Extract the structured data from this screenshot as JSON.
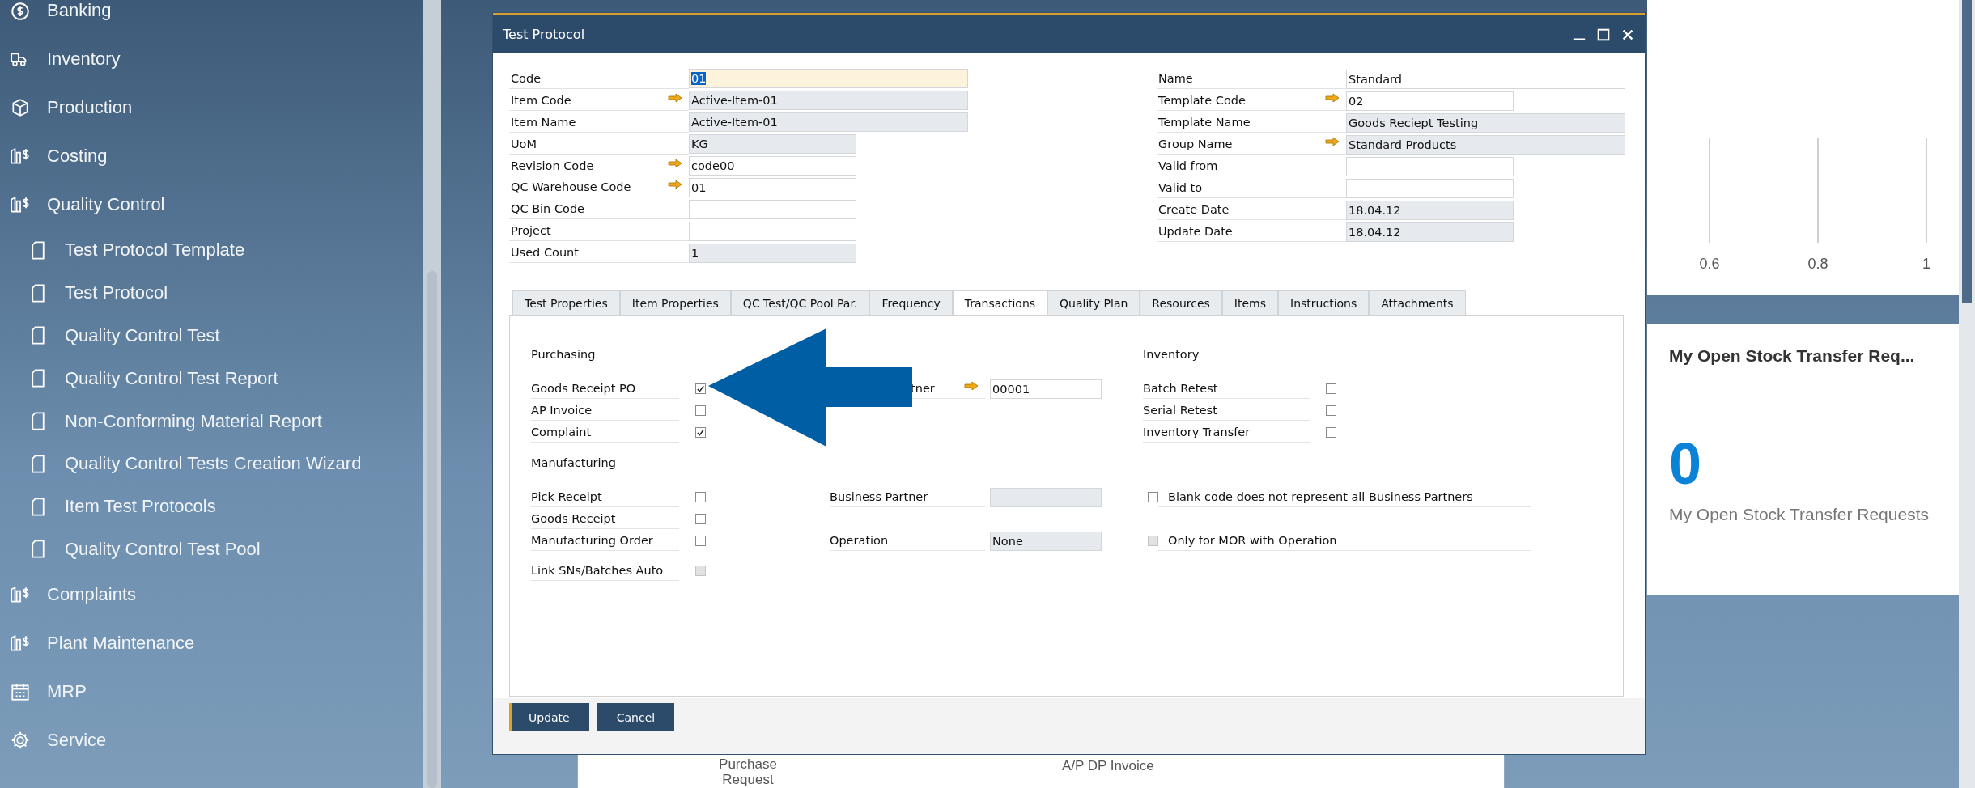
{
  "sidebar": {
    "items": [
      {
        "label": "Banking"
      },
      {
        "label": "Inventory"
      },
      {
        "label": "Production"
      },
      {
        "label": "Costing"
      },
      {
        "label": "Quality Control",
        "children": [
          {
            "label": "Test Protocol Template"
          },
          {
            "label": "Test Protocol"
          },
          {
            "label": "Quality Control Test"
          },
          {
            "label": "Quality Control Test Report"
          },
          {
            "label": "Non-Conforming Material Report"
          },
          {
            "label": "Quality Control Tests Creation Wizard"
          },
          {
            "label": "Item Test Protocols"
          },
          {
            "label": "Quality Control Test Pool"
          }
        ]
      },
      {
        "label": "Complaints"
      },
      {
        "label": "Plant Maintenance"
      },
      {
        "label": "MRP"
      },
      {
        "label": "Service"
      }
    ]
  },
  "background_chart": {
    "axis_labels": [
      "0.6",
      "0.8",
      "1"
    ]
  },
  "stock_transfer_card": {
    "title": "My Open Stock Transfer Req...",
    "count": "0",
    "caption": "My Open Stock Transfer Requests"
  },
  "background_window": {
    "items": [
      "Purchase Request",
      "A/P DP Invoice"
    ]
  },
  "dialog": {
    "title": "Test Protocol",
    "left_fields": [
      {
        "label": "Code",
        "value": "01",
        "kind": "focused",
        "link": false
      },
      {
        "label": "Item Code",
        "value": "Active-Item-01",
        "kind": "readonly",
        "link": true
      },
      {
        "label": "Item Name",
        "value": "Active-Item-01",
        "kind": "readonly",
        "link": false
      },
      {
        "label": "UoM",
        "value": "KG",
        "kind": "readonly",
        "link": false
      },
      {
        "label": "Revision Code",
        "value": "code00",
        "kind": "editable",
        "link": true
      },
      {
        "label": "QC Warehouse Code",
        "value": "01",
        "kind": "editable",
        "link": true
      },
      {
        "label": "QC Bin Code",
        "kind": "editable",
        "link": false
      },
      {
        "label": "Project",
        "kind": "editable",
        "link": false
      },
      {
        "label": "Used Count",
        "value": "1",
        "kind": "readonly",
        "link": false
      }
    ],
    "right_fields": [
      {
        "label": "Name",
        "value": "Standard",
        "kind": "editable",
        "link": false
      },
      {
        "label": "Template Code",
        "value": "02",
        "kind": "editable",
        "link": true
      },
      {
        "label": "Template Name",
        "value": "Goods Reciept Testing",
        "kind": "readonly",
        "link": false
      },
      {
        "label": "Group Name",
        "value": "Standard Products",
        "kind": "readonly",
        "link": true
      },
      {
        "label": "Valid from",
        "kind": "editable",
        "link": false
      },
      {
        "label": "Valid to",
        "kind": "editable",
        "link": false
      },
      {
        "label": "Create Date",
        "value": "18.04.12",
        "kind": "readonly",
        "link": false
      },
      {
        "label": "Update Date",
        "value": "18.04.12",
        "kind": "readonly",
        "link": false
      }
    ],
    "tabs": [
      {
        "label": "Test Properties",
        "selected": false
      },
      {
        "label": "Item Properties",
        "selected": false
      },
      {
        "label": "QC Test/QC Pool Par.",
        "selected": false
      },
      {
        "label": "Frequency",
        "selected": false
      },
      {
        "label": "Transactions",
        "selected": true
      },
      {
        "label": "Quality Plan",
        "selected": false
      },
      {
        "label": "Resources",
        "selected": false
      },
      {
        "label": "Items",
        "selected": false
      },
      {
        "label": "Instructions",
        "selected": false
      },
      {
        "label": "Attachments",
        "selected": false
      }
    ],
    "transactions": {
      "sections": [
        [
          {
            "left": {
              "kind": "heading",
              "label": "Purchasing"
            },
            "right": {
              "kind": "heading",
              "label": "Inventory"
            }
          },
          {
            "left": {
              "kind": "checkbox",
              "label": "Goods Receipt PO",
              "checked": true,
              "disabled": false
            },
            "middle": {
              "kind": "field",
              "label": "tner",
              "value": "00001",
              "readonly": false,
              "link": true,
              "covered": true
            },
            "right": {
              "kind": "checkbox",
              "label": "Batch Retest",
              "checked": false,
              "disabled": false
            }
          },
          {
            "left": {
              "kind": "checkbox",
              "label": "AP Invoice",
              "checked": false,
              "disabled": false
            },
            "right": {
              "kind": "checkbox",
              "label": "Serial Retest",
              "checked": false,
              "disabled": false
            }
          },
          {
            "left": {
              "kind": "checkbox",
              "label": "Complaint",
              "checked": true,
              "disabled": false
            },
            "right": {
              "kind": "checkbox",
              "label": "Inventory Transfer",
              "checked": false,
              "disabled": false
            }
          }
        ],
        [
          {
            "left": {
              "kind": "heading",
              "label": "Manufacturing"
            }
          },
          {
            "left": {
              "kind": "checkbox",
              "label": "Pick Receipt",
              "checked": false,
              "disabled": false
            },
            "middle": {
              "kind": "field",
              "label": "Business Partner",
              "readonly": true,
              "link": false,
              "covered": false
            },
            "right": {
              "kind": "option",
              "label": "Blank code does not represent all Business Partners",
              "checked": false,
              "disabled": false
            }
          },
          {
            "left": {
              "kind": "checkbox",
              "label": "Goods Receipt",
              "checked": false,
              "disabled": false
            }
          },
          {
            "left": {
              "kind": "checkbox",
              "label": "Manufacturing Order",
              "checked": false,
              "disabled": false
            },
            "middle": {
              "kind": "field",
              "label": "Operation",
              "value": "None",
              "readonly": true,
              "link": false,
              "covered": false
            },
            "right": {
              "kind": "option",
              "label": "Only for MOR with Operation",
              "checked": false,
              "disabled": true
            }
          }
        ],
        [
          {
            "left": {
              "kind": "checkbox",
              "label": "Link SNs/Batches Auto",
              "checked": false,
              "disabled": true
            }
          }
        ]
      ]
    },
    "buttons": [
      {
        "label": "Update",
        "kind": "primary"
      },
      {
        "label": "Cancel",
        "kind": "secondary"
      }
    ]
  }
}
